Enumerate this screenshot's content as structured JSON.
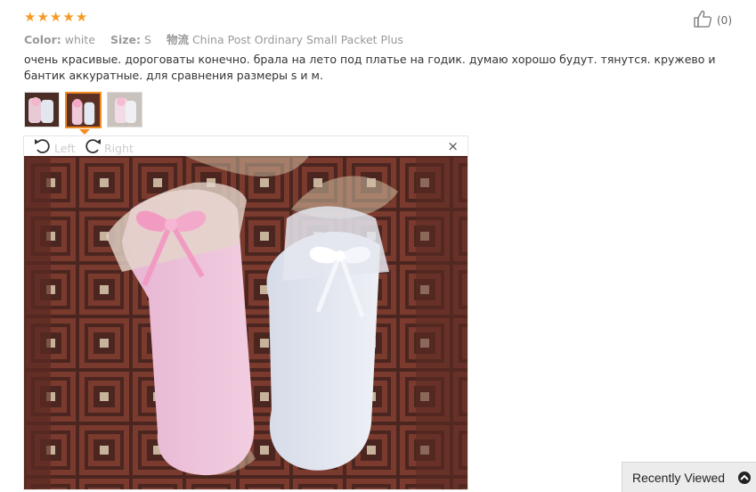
{
  "rating": {
    "stars": 5,
    "icon": "star-icon",
    "color": "#f59a23"
  },
  "helpful": {
    "icon": "thumbs-up-icon",
    "count": "(0)"
  },
  "meta": {
    "color_label": "Color:",
    "color_value": "white",
    "size_label": "Size:",
    "size_value": "S",
    "shipping_icon": "物流",
    "shipping_value": "China Post Ordinary Small Packet Plus"
  },
  "review": {
    "text": "очень красивые. дороговаты конечно. брала на лето под платье на годик. думаю хорошо будут. тянутся. кружево и бантик аккуратные. для сравнения размеры s и м."
  },
  "thumbnails": {
    "count": 3,
    "active_index": 1,
    "active_color": "#f58b1f"
  },
  "viewer": {
    "rotate_left_label": "Left",
    "rotate_right_label": "Right",
    "close_label": "×"
  },
  "recently_viewed": {
    "label": "Recently Viewed",
    "icon": "chevron-up-circle-icon"
  }
}
